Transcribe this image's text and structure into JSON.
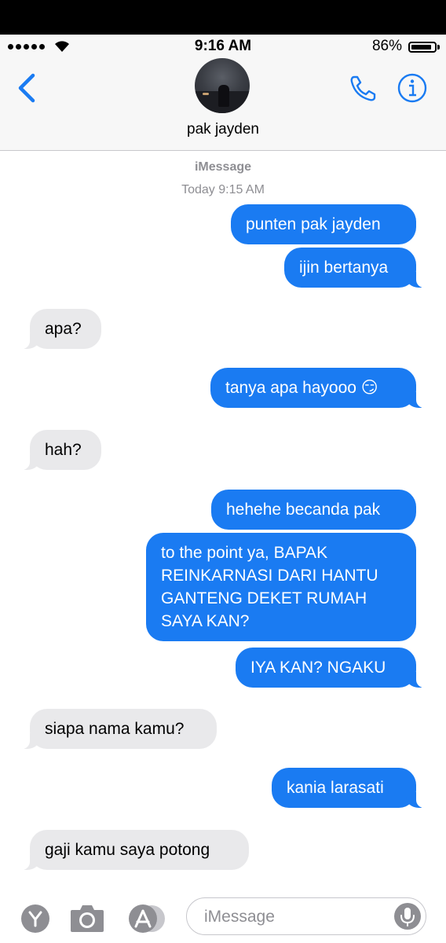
{
  "status": {
    "time": "9:16 AM",
    "battery": "86%",
    "battery_level": 0.86
  },
  "contact": {
    "name": "pak jayden"
  },
  "thread": {
    "service": "iMessage",
    "timestamp": "Today 9:15 AM"
  },
  "messages": [
    {
      "from": "me",
      "text": "punten pak jayden"
    },
    {
      "from": "me",
      "text": "ijin bertanya"
    },
    {
      "from": "them",
      "text": "apa?"
    },
    {
      "from": "me",
      "text": "tanya apa hayooo 😏"
    },
    {
      "from": "them",
      "text": "hah?"
    },
    {
      "from": "me",
      "text": "hehehe becanda pak"
    },
    {
      "from": "me",
      "text": "to the point ya, BAPAK\nREINKARNASI DARI HANTU\nGANTENG DEKET RUMAH\nSAYA KAN?"
    },
    {
      "from": "me",
      "text": "IYA KAN? NGAKU"
    },
    {
      "from": "them",
      "text": "siapa nama kamu?"
    },
    {
      "from": "me",
      "text": "kania larasati"
    },
    {
      "from": "them",
      "text": "gaji kamu saya potong"
    }
  ],
  "composer": {
    "placeholder": "iMessage"
  },
  "colors": {
    "accent": "#1a7bf2",
    "received_bubble": "#e9e9eb"
  },
  "icons": [
    "back-chevron-icon",
    "phone-icon",
    "info-icon",
    "app-drawer-icon",
    "camera-icon",
    "app-store-icon",
    "microphone-icon"
  ]
}
